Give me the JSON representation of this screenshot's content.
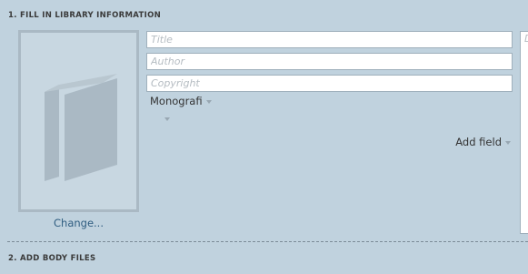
{
  "step1": {
    "title": "1. FILL IN LIBRARY INFORMATION"
  },
  "cover": {
    "icon": "book-icon",
    "change_label": "Change..."
  },
  "fields": {
    "title_placeholder": "Title",
    "author_placeholder": "Author",
    "copyright_placeholder": "Copyright"
  },
  "type_dropdown": {
    "value": "Monografi"
  },
  "add_field_label": "Add field",
  "right_panel": {
    "placeholder_initial": "D"
  },
  "step2": {
    "title": "2. ADD BODY FILES"
  },
  "colors": {
    "background": "#c0d2de",
    "link": "#2f5d80"
  }
}
